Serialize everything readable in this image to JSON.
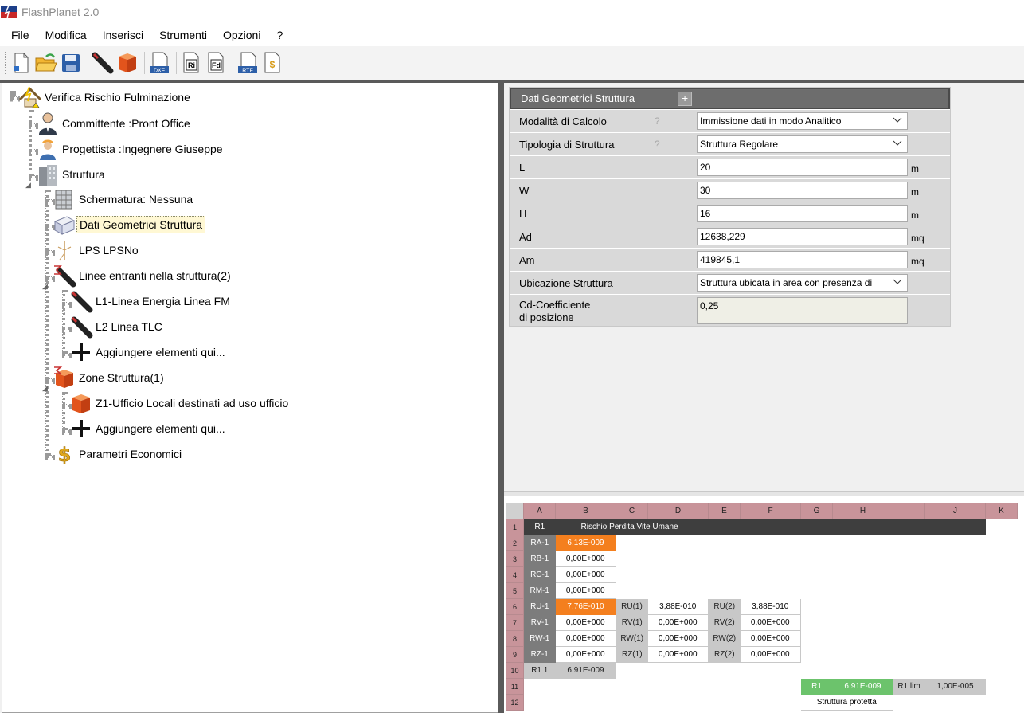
{
  "app": {
    "title": "FlashPlanet 2.0"
  },
  "menu": [
    "File",
    "Modifica",
    "Inserisci",
    "Strumenti",
    "Opzioni",
    "?"
  ],
  "toolbar": [
    {
      "icon": "new-document-icon"
    },
    {
      "icon": "open-folder-icon"
    },
    {
      "icon": "save-disk-icon"
    },
    {
      "icon": "cable-icon"
    },
    {
      "icon": "zone-box-icon"
    },
    {
      "icon": "dxf-export-icon",
      "text": "DXF"
    },
    {
      "icon": "report-ri-icon",
      "text": "Ri"
    },
    {
      "icon": "report-fd-icon",
      "text": "Fd"
    },
    {
      "icon": "rtf-export-icon",
      "text": "RTF"
    },
    {
      "icon": "economic-report-icon",
      "text": "$"
    }
  ],
  "tree": {
    "root": "Verifica Rischio Fulminazione",
    "committente": "Committente :Pront Office",
    "progettista": "Progettista :Ingegnere Giuseppe",
    "struttura": "Struttura",
    "schermatura": "Schermatura: Nessuna",
    "dati_geometrici": "Dati Geometrici Struttura",
    "lps": "LPS LPSNo",
    "linee": "Linee entranti nella struttura(2)",
    "linea1": "L1-Linea Energia Linea FM",
    "linea2": "L2 Linea TLC",
    "aggiungi1": "Aggiungere elementi qui...",
    "zone": "Zone Struttura(1)",
    "zona1": "Z1-Ufficio Locali destinati ad uso ufficio",
    "aggiungi2": "Aggiungere elementi qui...",
    "parametri": "Parametri Economici"
  },
  "props": {
    "header": "Dati Geometrici Struttura",
    "plus": "+",
    "help": "?",
    "rows": {
      "modalita": {
        "name": "Modalità di Calcolo",
        "value": "Immissione dati in modo Analitico"
      },
      "tipologia": {
        "name": "Tipologia di Struttura",
        "value": "Struttura Regolare"
      },
      "L": {
        "name": "L",
        "value": "20",
        "unit": "m"
      },
      "W": {
        "name": "W",
        "value": "30",
        "unit": "m"
      },
      "H": {
        "name": "H",
        "value": "16",
        "unit": "m"
      },
      "Ad": {
        "name": "Ad",
        "value": "12638,229",
        "unit": "mq"
      },
      "Am": {
        "name": "Am",
        "value": "419845,1",
        "unit": "mq"
      },
      "ubicazione": {
        "name": "Ubicazione Struttura",
        "value": "Struttura ubicata in area con presenza di"
      },
      "cd": {
        "name": "Cd-Coefficiente di posizione",
        "value": "0,25"
      }
    }
  },
  "sheet": {
    "columns": [
      "A",
      "B",
      "C",
      "D",
      "E",
      "F",
      "G",
      "H",
      "I",
      "J",
      "K"
    ],
    "r1": {
      "a": "R1",
      "b": "Rischio Perdita Vite Umane"
    },
    "rows": [
      {
        "n": "2",
        "a": "RA-1",
        "b": "6,13E-009"
      },
      {
        "n": "3",
        "a": "RB-1",
        "b": "0,00E+000"
      },
      {
        "n": "4",
        "a": "RC-1",
        "b": "0,00E+000"
      },
      {
        "n": "5",
        "a": "RM-1",
        "b": "0,00E+000"
      },
      {
        "n": "6",
        "a": "RU-1",
        "b": "7,76E-010",
        "c": "RU(1)",
        "d": "3,88E-010",
        "e": "RU(2)",
        "f": "3,88E-010"
      },
      {
        "n": "7",
        "a": "RV-1",
        "b": "0,00E+000",
        "c": "RV(1)",
        "d": "0,00E+000",
        "e": "RV(2)",
        "f": "0,00E+000"
      },
      {
        "n": "8",
        "a": "RW-1",
        "b": "0,00E+000",
        "c": "RW(1)",
        "d": "0,00E+000",
        "e": "RW(2)",
        "f": "0,00E+000"
      },
      {
        "n": "9",
        "a": "RZ-1",
        "b": "0,00E+000",
        "c": "RZ(1)",
        "d": "0,00E+000",
        "e": "RZ(2)",
        "f": "0,00E+000"
      },
      {
        "n": "10",
        "a": "R1 1",
        "b": "6,91E-009"
      }
    ],
    "r11": {
      "n": "11",
      "g": "R1",
      "h": "6,91E-009",
      "i": "R1 lim",
      "j": "1,00E-005"
    },
    "r12": {
      "n": "12",
      "gh": "Struttura protetta"
    }
  }
}
